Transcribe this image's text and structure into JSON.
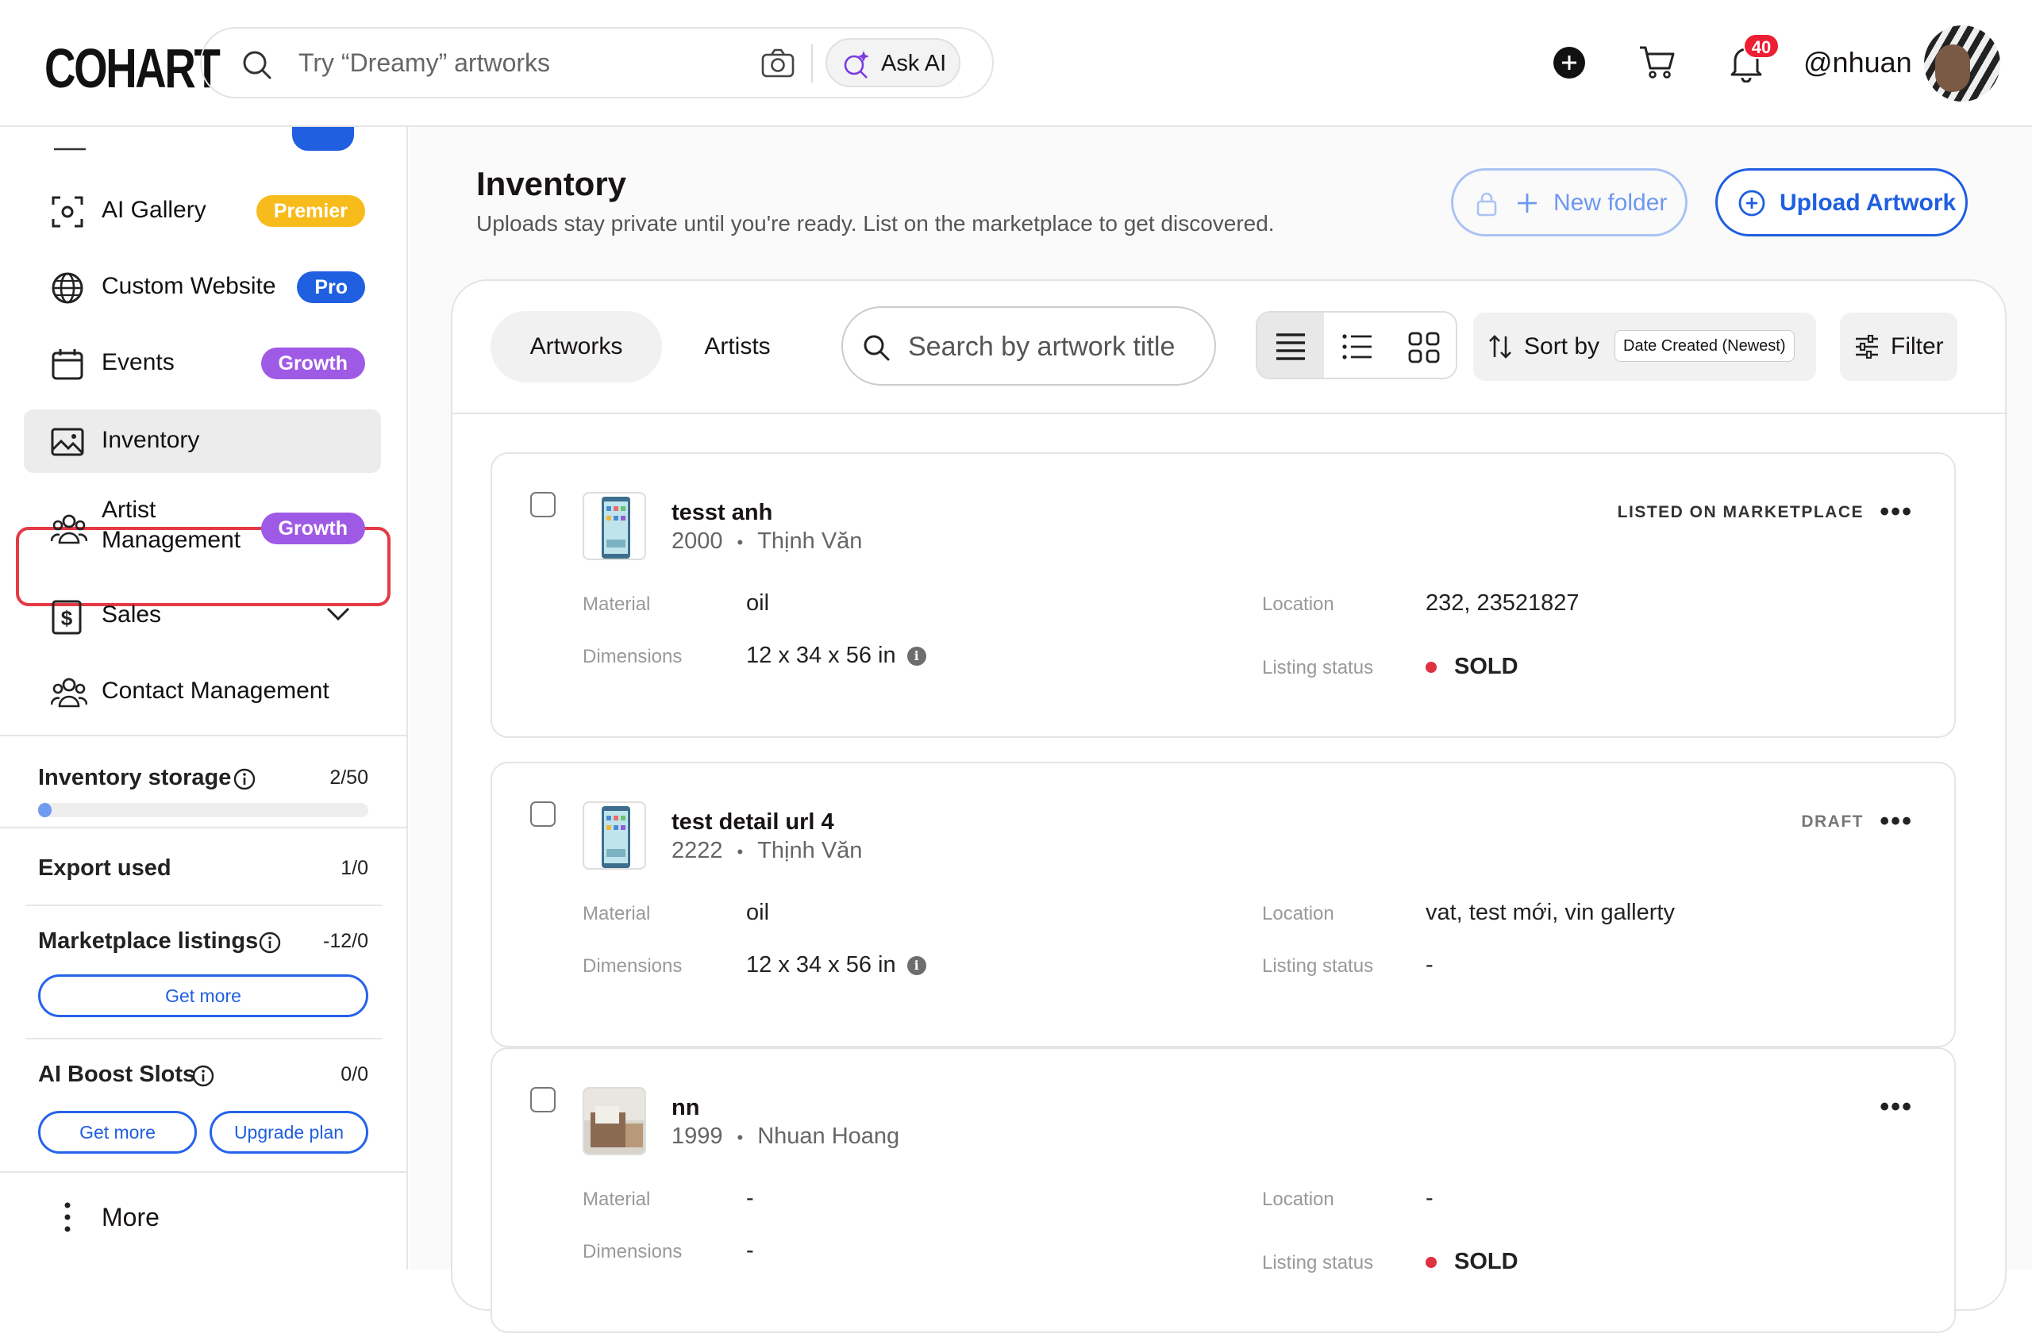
{
  "header": {
    "logo": "COHART",
    "search_placeholder": "Try “Dreamy” artworks",
    "ask_ai": "Ask AI",
    "notification_count": "40",
    "username": "@nhuan"
  },
  "sidebar": {
    "items": [
      {
        "label": "AI Gallery",
        "badge": "Premier",
        "badge_color": "#f7bc1c"
      },
      {
        "label": "Custom Website",
        "badge": "Pro",
        "badge_color": "#1f5fe0"
      },
      {
        "label": "Events",
        "badge": "Growth",
        "badge_color": "#9f5ae5"
      },
      {
        "label": "Inventory"
      },
      {
        "label": "Artist Management",
        "badge": "Growth",
        "badge_color": "#9f5ae5"
      },
      {
        "label": "Sales"
      },
      {
        "label": "Contact Management"
      }
    ],
    "inventory_storage": {
      "label": "Inventory storage",
      "value": "2/50",
      "fraction": 0.04
    },
    "export_used": {
      "label": "Export used",
      "value": "1/0"
    },
    "marketplace_listings": {
      "label": "Marketplace listings",
      "value": "-12/0",
      "button": "Get more"
    },
    "ai_boost": {
      "label": "AI Boost Slots",
      "value": "0/0",
      "button1": "Get more",
      "button2": "Upgrade plan"
    },
    "more": "More"
  },
  "main": {
    "title": "Inventory",
    "subtitle": "Uploads stay private until you're ready. List on the marketplace to get discovered.",
    "new_folder": "New folder",
    "upload": "Upload Artwork",
    "tabs": [
      "Artworks",
      "Artists"
    ],
    "search_placeholder": "Search by artwork title",
    "sort_label": "Sort by",
    "sort_value": "Date Created (Newest)",
    "filter": "Filter",
    "labels": {
      "material": "Material",
      "dimensions": "Dimensions",
      "location": "Location",
      "listing_status": "Listing status"
    },
    "artworks": [
      {
        "title": "tesst anh",
        "year": "2000",
        "artist": "Thịnh Văn",
        "status": "LISTED ON MARKETPLACE",
        "material": "oil",
        "dimensions": "12 x 34 x 56 in",
        "location": "232, 23521827",
        "listing": "SOLD"
      },
      {
        "title": "test detail url 4",
        "year": "2222",
        "artist": "Thịnh Văn",
        "status": "DRAFT",
        "material": "oil",
        "dimensions": "12 x 34 x 56 in",
        "location": "vat, test mới, vin gallerty",
        "listing": "-"
      },
      {
        "title": "nn",
        "year": "1999",
        "artist": "Nhuan Hoang",
        "status": "",
        "material": "-",
        "dimensions": "-",
        "location": "-",
        "listing": "SOLD"
      }
    ]
  }
}
